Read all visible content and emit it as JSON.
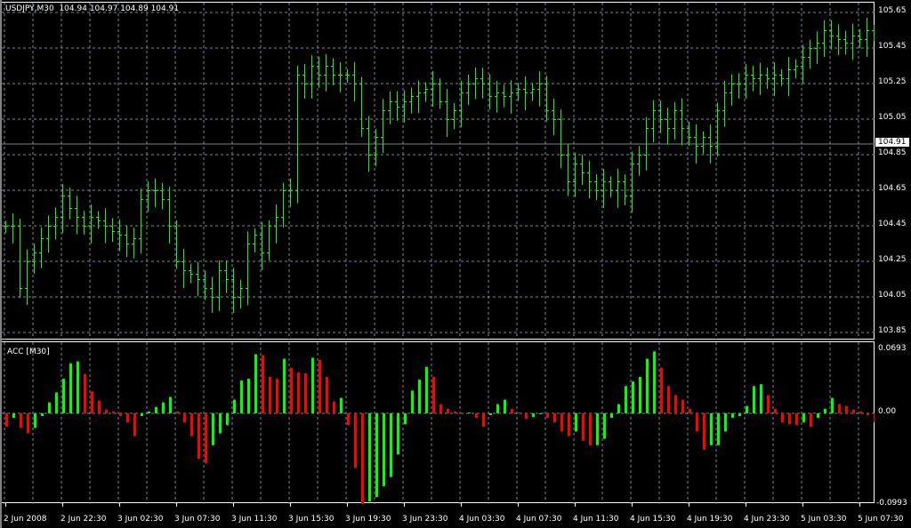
{
  "header": {
    "symbol": "USDJPY,M30",
    "open": "104.94",
    "high": "104.97",
    "low": "104.89",
    "close": "104.91"
  },
  "indicator": {
    "title": "ACC [M30]",
    "max_label": "0.0693",
    "zero_label": "0.00",
    "min_label": "-0.0993"
  },
  "current_price": "104.91",
  "price_axis": [
    "105.65",
    "105.45",
    "105.25",
    "105.05",
    "104.85",
    "104.65",
    "104.45",
    "104.25",
    "104.05",
    "103.85"
  ],
  "time_axis": [
    "2 Jun 2008",
    "2 Jun 22:30",
    "3 Jun 02:30",
    "3 Jun 07:30",
    "3 Jun 11:30",
    "3 Jun 15:30",
    "3 Jun 19:30",
    "3 Jun 23:30",
    "4 Jun 03:30",
    "4 Jun 07:30",
    "4 Jun 11:30",
    "4 Jun 15:30",
    "4 Jun 19:30",
    "4 Jun 23:30",
    "5 Jun 03:30",
    "5 Jun 07:30"
  ],
  "colors": {
    "bar": "#00ff00",
    "up": "#00ff00",
    "down": "#ff0000",
    "grid": "#778899",
    "price_line": "#808080"
  },
  "chart_data": {
    "type": "ohlc",
    "price_range": [
      103.8,
      105.67
    ],
    "close": [
      104.45,
      104.45,
      104.1,
      104.25,
      104.3,
      104.38,
      104.45,
      104.5,
      104.62,
      104.55,
      104.5,
      104.45,
      104.5,
      104.48,
      104.45,
      104.42,
      104.4,
      104.35,
      104.38,
      104.6,
      104.65,
      104.65,
      104.6,
      104.45,
      104.25,
      104.2,
      104.18,
      104.15,
      104.1,
      104.05,
      104.2,
      104.15,
      104.05,
      104.1,
      104.35,
      104.4,
      104.3,
      104.45,
      104.5,
      104.65,
      104.65,
      105.3,
      105.25,
      105.35,
      105.3,
      105.35,
      105.3,
      105.3,
      105.3,
      105.25,
      105.0,
      104.85,
      104.95,
      105.1,
      105.15,
      105.12,
      105.15,
      105.18,
      105.2,
      105.22,
      105.25,
      105.15,
      105.05,
      105.1,
      105.2,
      105.25,
      105.28,
      105.25,
      105.18,
      105.2,
      105.18,
      105.2,
      105.22,
      105.2,
      105.22,
      105.25,
      105.1,
      105.05,
      104.85,
      104.7,
      104.8,
      104.75,
      104.7,
      104.65,
      104.7,
      104.65,
      104.7,
      104.62,
      104.8,
      104.85,
      105.0,
      105.1,
      105.05,
      105.0,
      105.1,
      105.0,
      104.95,
      104.9,
      104.95,
      104.9,
      105.1,
      105.2,
      105.25,
      105.25,
      105.3,
      105.28,
      105.3,
      105.28,
      105.3,
      105.28,
      105.33,
      105.35,
      105.4,
      105.45,
      105.48,
      105.55,
      105.52,
      105.5,
      105.48,
      105.52,
      105.5,
      105.55,
      105.53
    ],
    "acc_range": [
      -0.0993,
      0.0693
    ],
    "acc": [
      -0.015,
      -0.005,
      -0.016,
      -0.022,
      -0.016,
      -0.003,
      0.012,
      0.023,
      0.038,
      0.055,
      0.057,
      0.043,
      0.024,
      0.014,
      0.004,
      0.002,
      -0.003,
      -0.01,
      -0.025,
      -0.003,
      0.002,
      0.007,
      0.012,
      0.018,
      0.002,
      -0.01,
      -0.025,
      -0.05,
      -0.055,
      -0.035,
      -0.022,
      -0.013,
      0.015,
      0.036,
      0.038,
      0.065,
      0.064,
      0.04,
      0.038,
      0.06,
      0.05,
      0.045,
      0.044,
      0.061,
      0.059,
      0.04,
      0.013,
      0.017,
      -0.013,
      -0.06,
      -0.1,
      -0.097,
      -0.092,
      -0.08,
      -0.07,
      -0.045,
      -0.012,
      0.025,
      0.037,
      0.051,
      0.04,
      0.01,
      0.005,
      0.002,
      0.001,
      0.001,
      -0.005,
      -0.015,
      -0.002,
      0.01,
      0.015,
      0.005,
      0.001,
      -0.006,
      -0.004,
      -0.001,
      -0.005,
      -0.01,
      -0.02,
      -0.025,
      -0.02,
      -0.03,
      -0.035,
      -0.035,
      -0.028,
      -0.005,
      0.01,
      0.03,
      0.035,
      0.04,
      0.06,
      0.068,
      0.05,
      0.03,
      0.02,
      0.015,
      0.005,
      -0.02,
      -0.04,
      -0.035,
      -0.035,
      -0.02,
      -0.005,
      -0.003,
      0.008,
      0.03,
      0.032,
      0.02,
      0.005,
      -0.01,
      -0.012,
      -0.013,
      -0.01,
      -0.015,
      -0.005,
      0.005,
      0.017,
      0.01,
      0.008,
      0.004,
      0.002,
      -0.002,
      -0.01
    ]
  }
}
